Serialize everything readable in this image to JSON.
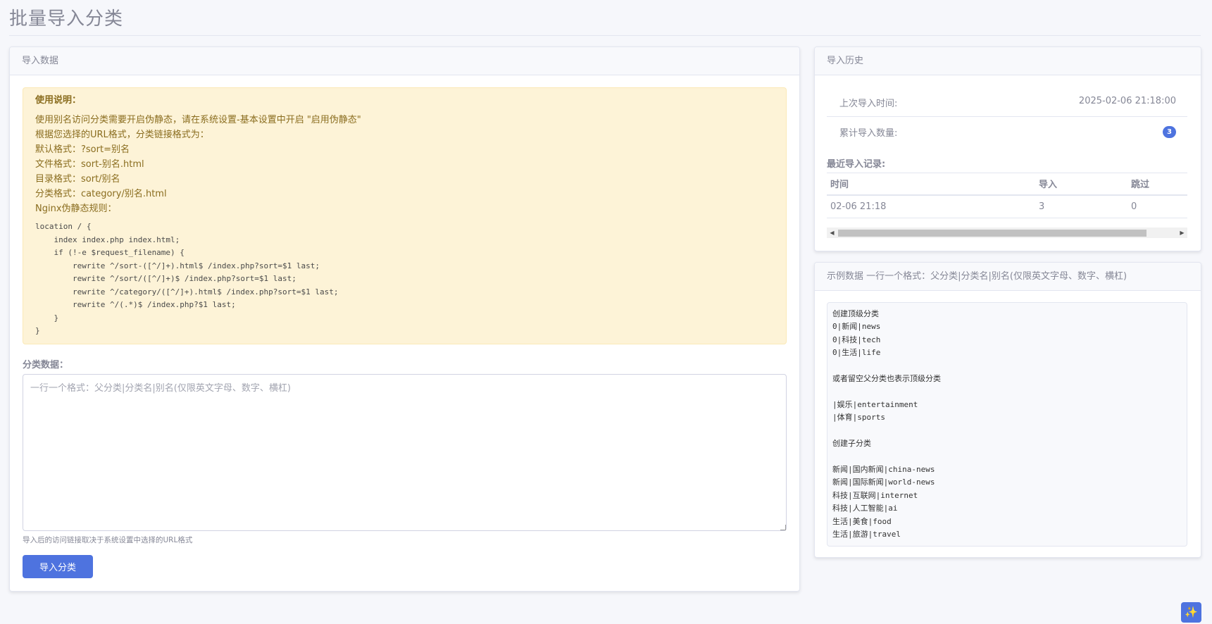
{
  "page": {
    "title": "批量导入分类"
  },
  "import_card": {
    "header": "导入数据",
    "notice": {
      "title": "使用说明：",
      "lines": [
        "使用别名访问分类需要开启伪静态，请在系统设置-基本设置中开启 \"启用伪静态\"",
        "根据您选择的URL格式，分类链接格式为：",
        "默认格式：?sort=别名",
        "文件格式：sort-别名.html",
        "目录格式：sort/别名",
        "分类格式：category/别名.html",
        "Nginx伪静态规则："
      ],
      "code": "location / {\n    index index.php index.html;\n    if (!-e $request_filename) {\n        rewrite ^/sort-([^/]+).html$ /index.php?sort=$1 last;\n        rewrite ^/sort/([^/]+)$ /index.php?sort=$1 last;\n        rewrite ^/category/([^/]+).html$ /index.php?sort=$1 last;\n        rewrite ^/(.*)$ /index.php?$1 last;\n    }\n}"
    },
    "field_label": "分类数据：",
    "textarea_value": "",
    "textarea_placeholder": "一行一个格式：父分类|分类名|别名(仅限英文字母、数字、横杠)",
    "help_text": "导入后的访问链接取决于系统设置中选择的URL格式",
    "submit_label": "导入分类"
  },
  "history_card": {
    "header": "导入历史",
    "last_import_label": "上次导入时间:",
    "last_import_value": "2025-02-06 21:18:00",
    "total_label": "累计导入数量:",
    "total_value": "3",
    "recent_label": "最近导入记录:",
    "table": {
      "headers": [
        "时间",
        "导入",
        "跳过"
      ],
      "rows": [
        [
          "02-06 21:18",
          "3",
          "0"
        ]
      ]
    }
  },
  "example_card": {
    "header": "示例数据 一行一个格式：父分类|分类名|别名(仅限英文字母、数字、横杠)",
    "content": "创建顶级分类\n0|新闻|news\n0|科技|tech\n0|生活|life\n\n或者留空父分类也表示顶级分类\n\n|娱乐|entertainment\n|体育|sports\n\n创建子分类\n\n新闻|国内新闻|china-news\n新闻|国际新闻|world-news\n科技|互联网|internet\n科技|人工智能|ai\n生活|美食|food\n生活|旅游|travel"
  },
  "fab": {
    "icon": "sparkle-icon",
    "glyph": "✨"
  }
}
